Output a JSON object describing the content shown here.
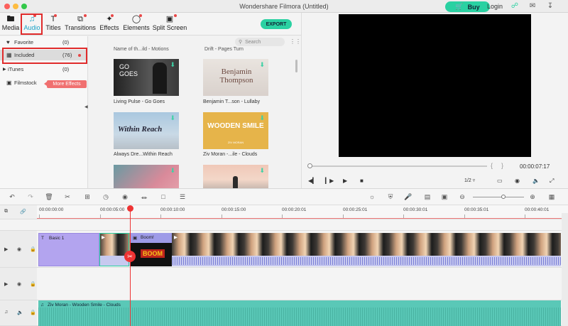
{
  "app": {
    "title": "Wondershare Filmora (Untitled)",
    "buy_label": "Buy",
    "login_label": "Login",
    "colors": {
      "accent": "#2ad1a2",
      "active_tab": "#1aa3c7",
      "highlight": "#e02b2b",
      "playhead": "#e33333"
    }
  },
  "toolbar": {
    "tabs": [
      {
        "label": "Media",
        "icon": "folder-icon"
      },
      {
        "label": "Audio",
        "icon": "music-note-icon",
        "active": true
      },
      {
        "label": "Titles",
        "icon": "text-icon"
      },
      {
        "label": "Transitions",
        "icon": "transition-icon"
      },
      {
        "label": "Effects",
        "icon": "effects-icon"
      },
      {
        "label": "Elements",
        "icon": "elements-icon"
      },
      {
        "label": "Split Screen",
        "icon": "split-screen-icon"
      }
    ],
    "export_label": "EXPORT"
  },
  "sidebar": {
    "items": [
      {
        "label": "Favorite",
        "count": "(0)",
        "icon": "heart-icon"
      },
      {
        "label": "Included",
        "count": "(76)",
        "icon": "grid-icon",
        "selected": true
      },
      {
        "label": "iTunes",
        "count": "(0)",
        "icon": "triangle-right-icon"
      },
      {
        "label": "Filmstock",
        "icon": "filmstock-icon"
      }
    ],
    "more_effects_label": "More Effects"
  },
  "library": {
    "search_placeholder": "Search",
    "cut_labels": [
      "Name of th...ild - Motions",
      "Drift - Pages Turn"
    ],
    "items": [
      {
        "label": "Living Pulse - Go Goes",
        "thumb_text": "GO GOES"
      },
      {
        "label": "Benjamin T...son - Lullaby",
        "thumb_text": "Benjamin Thompson"
      },
      {
        "label": "Always Dre...Within Reach",
        "thumb_text": "Within Reach"
      },
      {
        "label": "Ziv Moran -...ile - Clouds",
        "thumb_text": "WOODEN SMILE",
        "thumb_subtext": "ZIV MORAN"
      },
      {
        "label": "",
        "thumb_text": ""
      },
      {
        "label": "",
        "thumb_text": ""
      }
    ]
  },
  "preview": {
    "timecode": "00:00:07:17",
    "ratio": "1/2"
  },
  "timeline": {
    "ruler": [
      "00:00:00:00",
      "00:00:05:00",
      "00:00:10:00",
      "00:00:15:00",
      "00:00:20:01",
      "00:00:25:01",
      "00:00:30:01",
      "00:00:35:01",
      "00:00:40:01"
    ],
    "title_clip": "Basic 1",
    "boom_clip": "Boom!",
    "boom_text": "BOOM",
    "audio_clip": "Ziv Moran - Wooden Smile - Clouds"
  }
}
